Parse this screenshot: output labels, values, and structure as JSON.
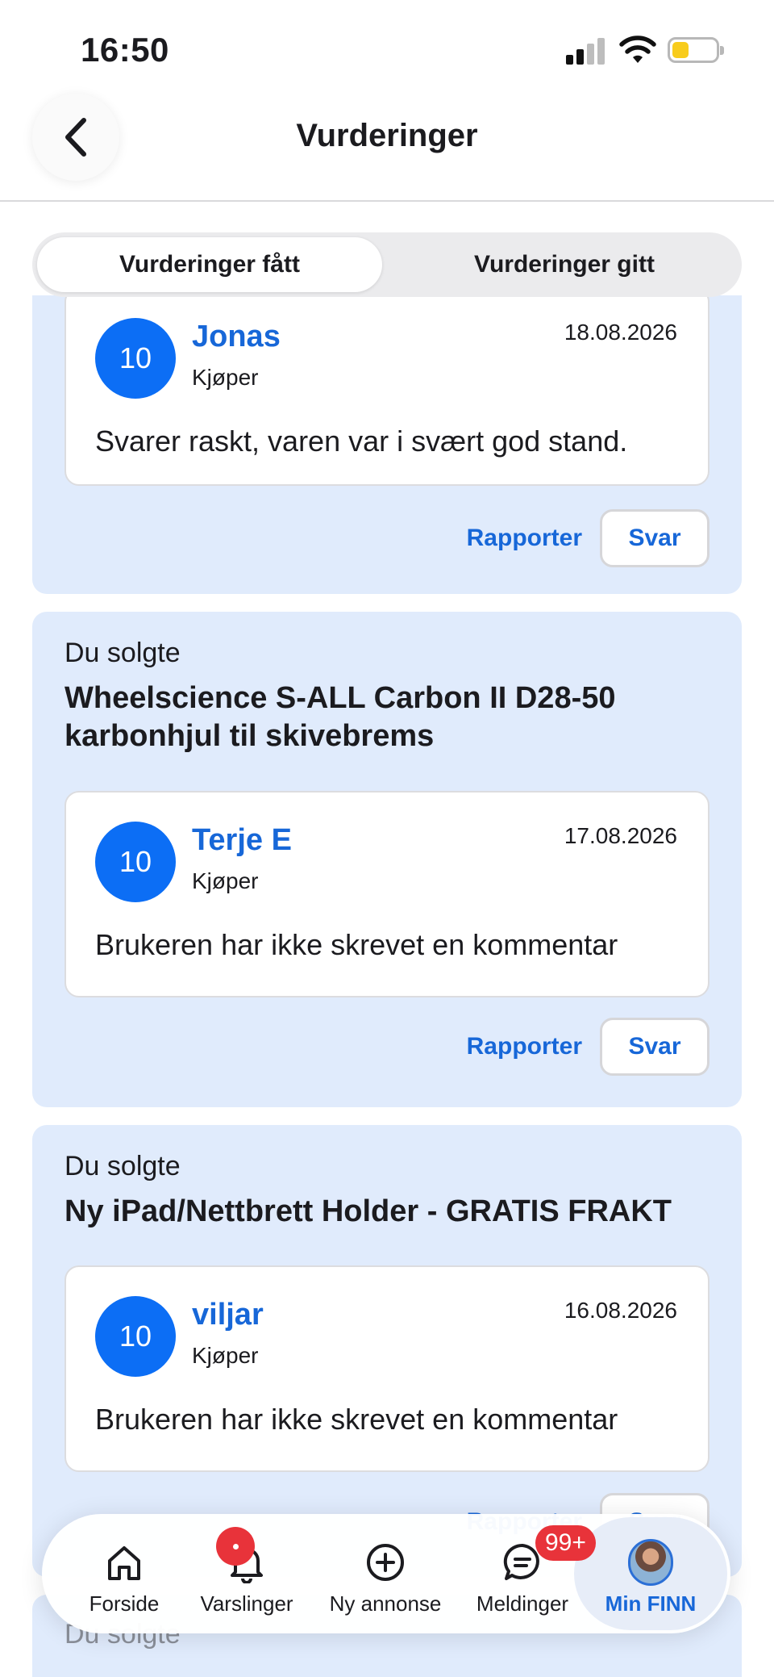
{
  "status_bar": {
    "time": "16:50"
  },
  "header": {
    "title": "Vurderinger"
  },
  "segments": {
    "received": "Vurderinger fått",
    "given": "Vurderinger gitt"
  },
  "sections": [
    {
      "review": {
        "score": "10",
        "name": "Jonas",
        "role": "Kjøper",
        "date": "18.08.2026",
        "comment": "Svarer raskt, varen var i svært god stand."
      },
      "report_label": "Rapporter",
      "reply_label": "Svar"
    },
    {
      "pre": "Du solgte",
      "title": "Wheelscience S-ALL Carbon II D28-50 karbonhjul til skivebrems",
      "review": {
        "score": "10",
        "name": "Terje E",
        "role": "Kjøper",
        "date": "17.08.2026",
        "comment": "Brukeren har ikke skrevet en kommentar"
      },
      "report_label": "Rapporter",
      "reply_label": "Svar"
    },
    {
      "pre": "Du solgte",
      "title": "Ny iPad/Nettbrett Holder - GRATIS FRAKT",
      "review": {
        "score": "10",
        "name": "viljar",
        "role": "Kjøper",
        "date": "16.08.2026",
        "comment": "Brukeren har ikke skrevet en kommentar"
      },
      "report_label": "Rapporter",
      "reply_label": "Svar"
    },
    {
      "pre": "Du solgte"
    }
  ],
  "tab_bar": {
    "items": [
      {
        "label": "Forside",
        "icon": "home-icon"
      },
      {
        "label": "Varslinger",
        "icon": "bell-icon"
      },
      {
        "label": "Ny annonse",
        "icon": "plus-circle-icon"
      },
      {
        "label": "Meldinger",
        "icon": "chat-icon"
      },
      {
        "label": "Min FINN",
        "icon": "avatar"
      }
    ],
    "messages_badge": "99+",
    "active": "Min FINN"
  },
  "colors": {
    "accent": "#1767d8",
    "score_bg": "#0c6ef5",
    "section_bg": "#e0ebfc",
    "badge": "#e8333a"
  }
}
